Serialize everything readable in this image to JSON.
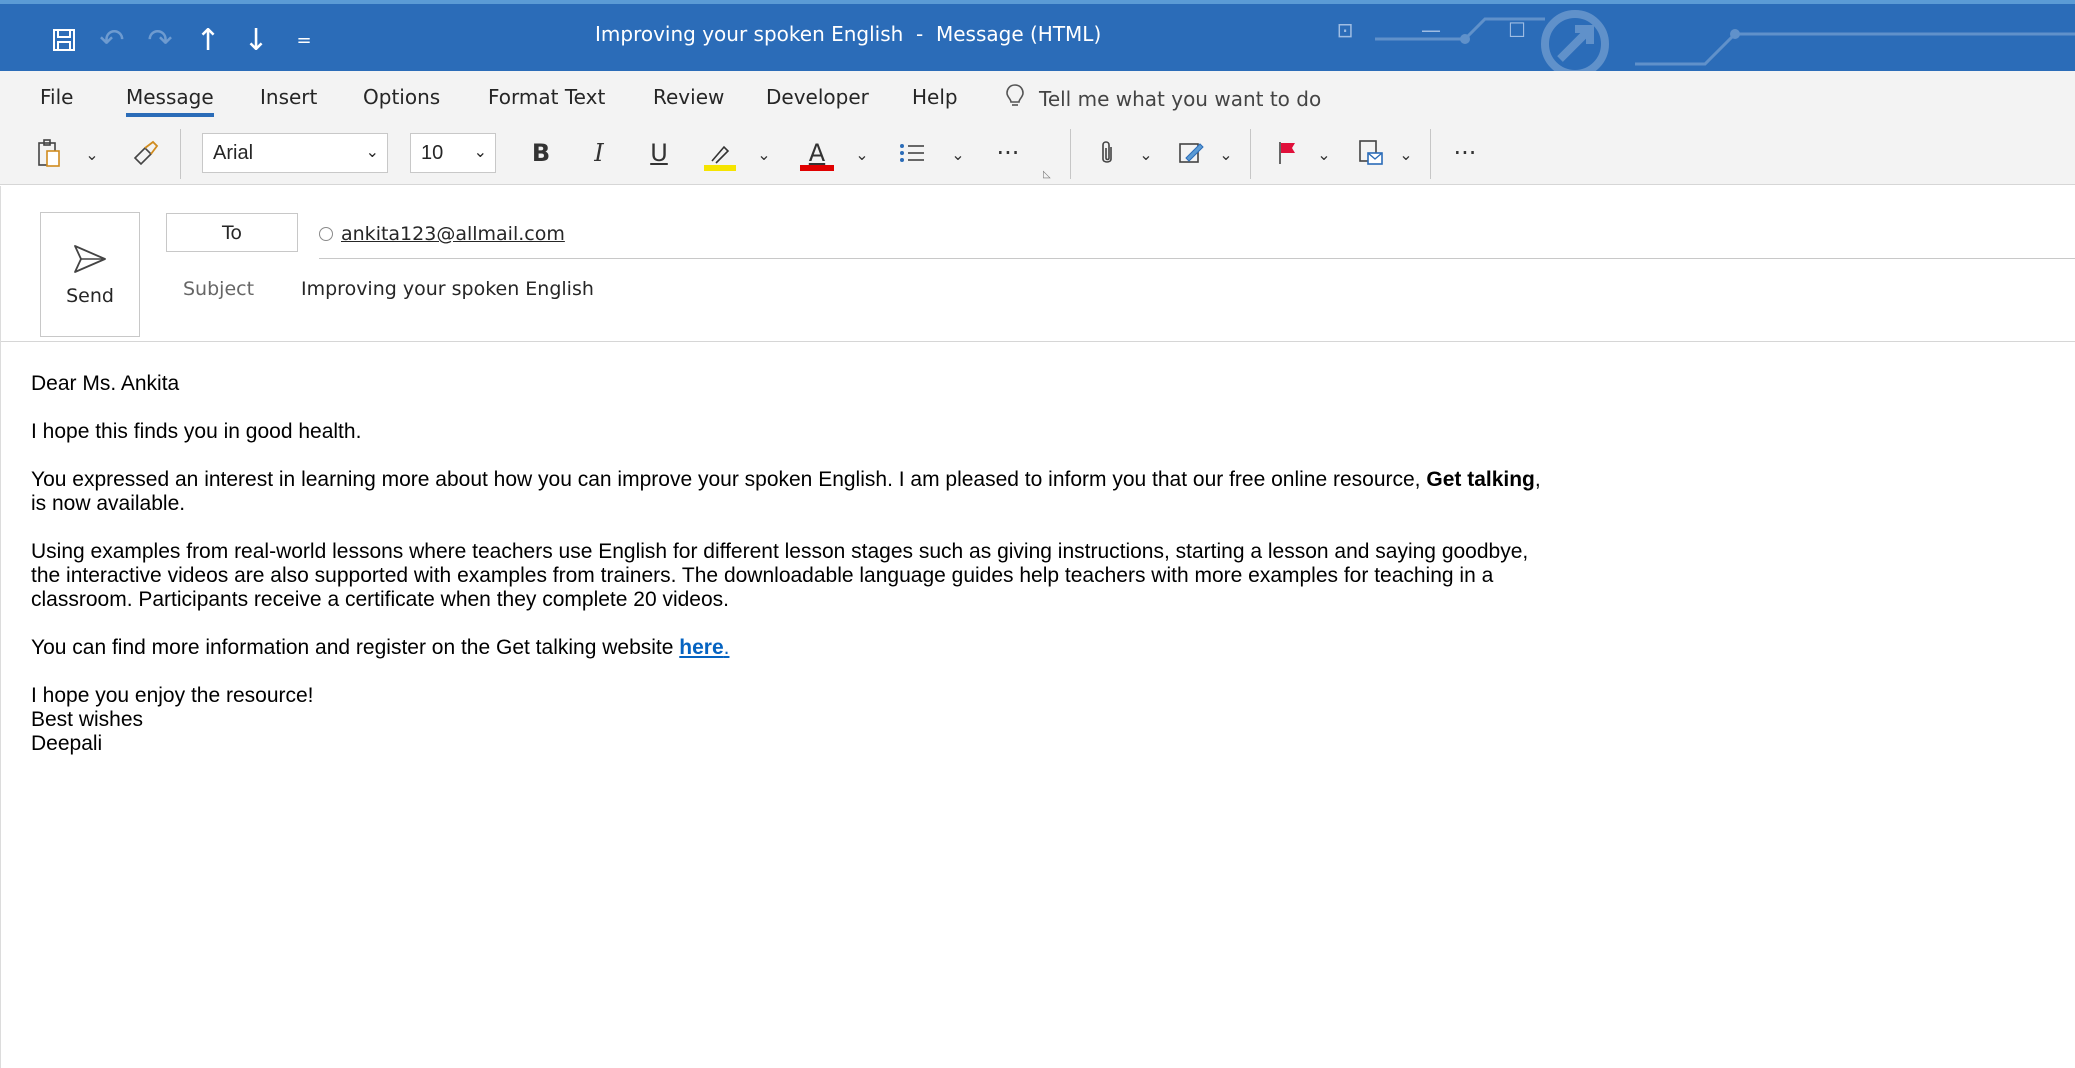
{
  "window": {
    "title": "Improving your spoken English  -  Message (HTML)",
    "quick_access": [
      {
        "icon": "save-icon",
        "glyph": "🖫"
      },
      {
        "icon": "undo-icon",
        "glyph": "↶"
      },
      {
        "icon": "redo-icon",
        "glyph": "↷"
      },
      {
        "icon": "up-arrow-icon",
        "glyph": "↑"
      },
      {
        "icon": "down-arrow-icon",
        "glyph": "↓"
      },
      {
        "icon": "customize-icon",
        "glyph": "="
      }
    ],
    "controls": [
      {
        "icon": "ribbon-display-icon",
        "glyph": "⊡"
      },
      {
        "icon": "minimize-icon",
        "glyph": "—"
      },
      {
        "icon": "maximize-icon",
        "glyph": "☐"
      }
    ]
  },
  "menu": {
    "tabs": [
      "File",
      "Message",
      "Insert",
      "Options",
      "Format Text",
      "Review",
      "Developer",
      "Help"
    ],
    "active_tab": "Message",
    "tell_me": "Tell me what you want to do"
  },
  "ribbon": {
    "font_name": "Arial",
    "font_size": "10",
    "bold": "B",
    "italic": "I",
    "underline": "U",
    "font_color_letter": "A",
    "more": "···",
    "highlight_color": "#f5e400",
    "font_color": "#e00000"
  },
  "compose": {
    "send_label": "Send",
    "to_label": "To",
    "to_address": "ankita123@allmail.com",
    "subject_label": "Subject",
    "subject_value": "Improving your spoken English"
  },
  "email": {
    "greeting": "Dear Ms. Ankita",
    "p1": "I hope this finds you in good health.",
    "p2_text": "You expressed an interest in learning more about how you can improve your spoken English. I am pleased to inform you that our free online resource, ",
    "p2_bold": "Get talking",
    "p2_tail": ", is now available.",
    "p3": "Using examples from real-world lessons where teachers use English for different lesson stages such as giving instructions, starting a lesson and saying goodbye, the interactive videos are also supported with examples from trainers. The downloadable language guides help teachers with more examples for teaching in a classroom. Participants receive a certificate when they complete 20 videos.",
    "p4_text": "You can find more information and register on the Get talking website ",
    "p4_link": "here",
    "p4_tail": ".",
    "closing1": "I hope you enjoy the resource!",
    "closing2": "Best wishes",
    "closing3": "Deepali"
  }
}
